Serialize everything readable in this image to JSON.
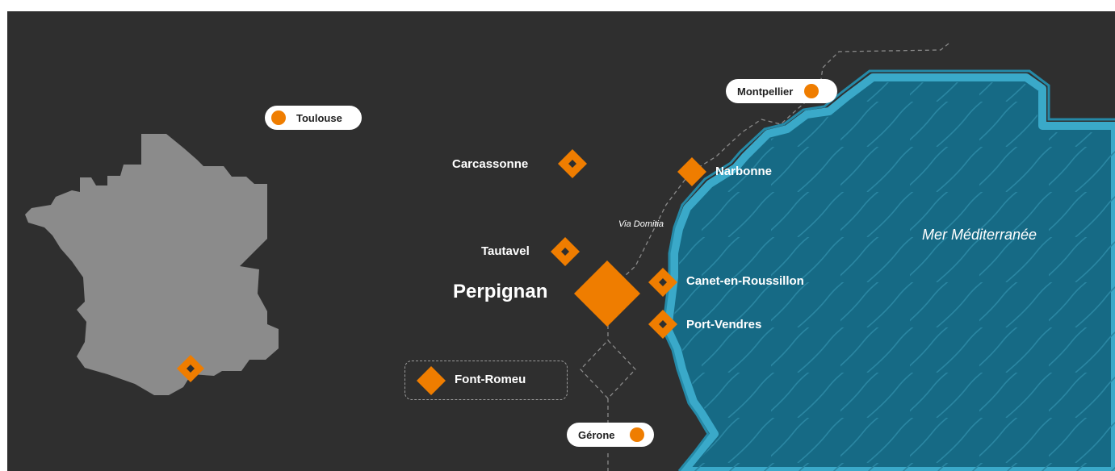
{
  "colors": {
    "background": "#2f2f2f",
    "land_france": "#8b8b8b",
    "sea": "#166a85",
    "coast_light": "#3aa9c9",
    "marker": "#ef7d00",
    "text": "#ffffff"
  },
  "map": {
    "sea_label": "Mer Méditerranée",
    "route_label": "Via Domitia"
  },
  "cities": {
    "toulouse": {
      "label": "Toulouse",
      "marker": "circle-pill"
    },
    "montpellier": {
      "label": "Montpellier",
      "marker": "circle-pill"
    },
    "gerone": {
      "label": "Gérone",
      "marker": "circle-pill"
    },
    "carcassonne": {
      "label": "Carcassonne",
      "marker": "diamond"
    },
    "narbonne": {
      "label": "Narbonne",
      "marker": "diamond"
    },
    "tautavel": {
      "label": "Tautavel",
      "marker": "diamond"
    },
    "perpignan": {
      "label": "Perpignan",
      "marker": "large-diamond"
    },
    "canet": {
      "label": "Canet-en-Roussillon",
      "marker": "diamond"
    },
    "port_vendres": {
      "label": "Port-Vendres",
      "marker": "diamond"
    },
    "font_romeu": {
      "label": "Font-Romeu",
      "marker": "diamond-boxed"
    }
  }
}
